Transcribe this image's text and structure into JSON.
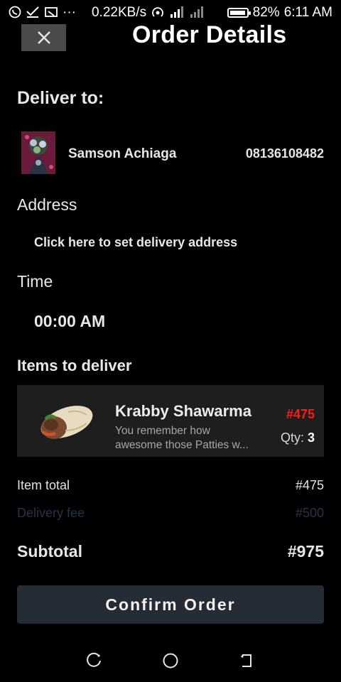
{
  "status_bar": {
    "net_speed": "0.22KB/s",
    "battery": "82%",
    "battery_level": 0.82,
    "time": "6:11 AM",
    "dots": "···"
  },
  "header": {
    "title": "Order Details"
  },
  "deliver_to": {
    "label": "Deliver to:",
    "name": "Samson Achiaga",
    "phone": "08136108482"
  },
  "address": {
    "label": "Address",
    "link": "Click here to set delivery address"
  },
  "time": {
    "label": "Time",
    "value": "00:00 AM"
  },
  "items": {
    "label": "Items to deliver",
    "list": [
      {
        "name": "Krabby Shawarma",
        "desc_line1": "You remember how",
        "desc_line2": "awesome those Patties w...",
        "price": "#475",
        "qty_label": "Qty:",
        "qty": "3"
      }
    ]
  },
  "summary": {
    "item_total_label": "Item total",
    "item_total": "#475",
    "delivery_label": "Delivery fee",
    "delivery": "#500",
    "subtotal_label": "Subtotal",
    "subtotal": "#975"
  },
  "actions": {
    "confirm": "Confirm Order"
  },
  "colors": {
    "price": "#ff1a1a",
    "button_bg": "#262c36",
    "card_bg": "#1e1e1e"
  }
}
